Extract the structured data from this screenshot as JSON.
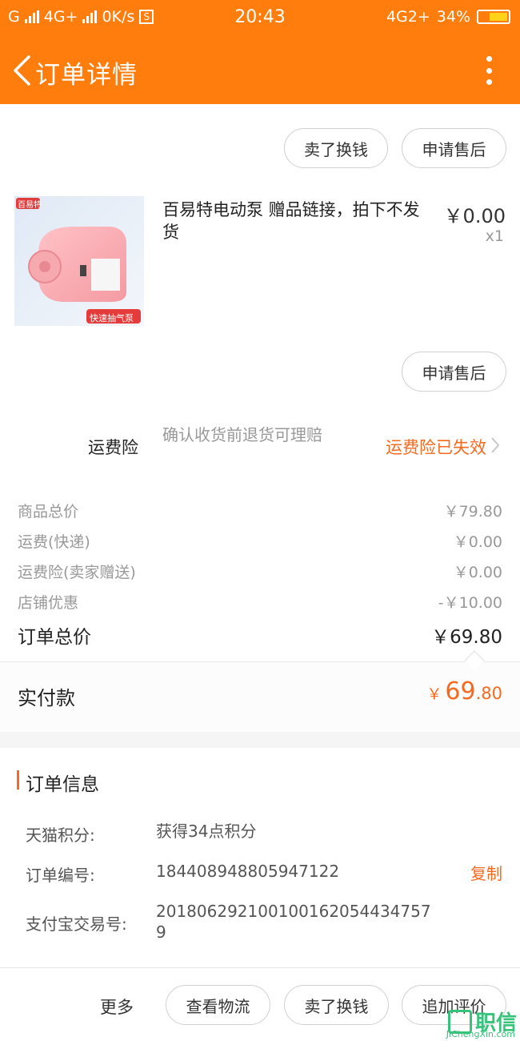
{
  "status_bar": {
    "left_text_1": "G",
    "left_text_2": "4G+",
    "speed": "0K/s",
    "s_badge": "S",
    "time": "20:43",
    "network_right": "4G2+",
    "battery": "34%"
  },
  "header": {
    "title": "订单详情",
    "back_icon": "chevron-left-icon",
    "more_icon": "more-vertical-icon"
  },
  "actions_top": {
    "sell_exchange": "卖了换钱",
    "after_sale": "申请售后"
  },
  "product": {
    "title": "百易特电动泵 赠品链接，拍下不发货",
    "price": "￥0.00",
    "quantity": "x1",
    "image_brand": "百易特",
    "image_tag": "快速抽气泵",
    "after_sale_button": "申请售后"
  },
  "insurance": {
    "label": "运费险",
    "description": "确认收货前退货可理赔",
    "status": "运费险已失效",
    "status_color": "#f56a1f"
  },
  "summary": {
    "rows": [
      {
        "label": "商品总价",
        "value": "￥79.80"
      },
      {
        "label": "运费(快递)",
        "value": "￥0.00"
      },
      {
        "label": "运费险(卖家赠送)",
        "value": "￥0.00"
      },
      {
        "label": "店铺优惠",
        "value": "-￥10.00"
      }
    ],
    "total_label": "订单总价",
    "total_value": "￥69.80"
  },
  "paid": {
    "label": "实付款",
    "currency": "￥",
    "integer": "69",
    "decimal": ".80"
  },
  "order_info": {
    "title": "订单信息",
    "points_label": "天猫积分:",
    "points_value": "获得34点积分",
    "order_no_label": "订单编号:",
    "order_no_value": "184408948805947122",
    "copy_label": "复制",
    "alipay_label": "支付宝交易号:",
    "alipay_value": "2018062921001001620544347579"
  },
  "bottom_bar": {
    "more": "更多",
    "logistics": "查看物流",
    "sell_exchange": "卖了换钱",
    "review": "追加评价"
  },
  "watermark": {
    "text": "职信",
    "sub": "JiChengXin.com"
  },
  "colors": {
    "brand_orange": "#fe7d0d",
    "accent_orange": "#f56a1f"
  }
}
